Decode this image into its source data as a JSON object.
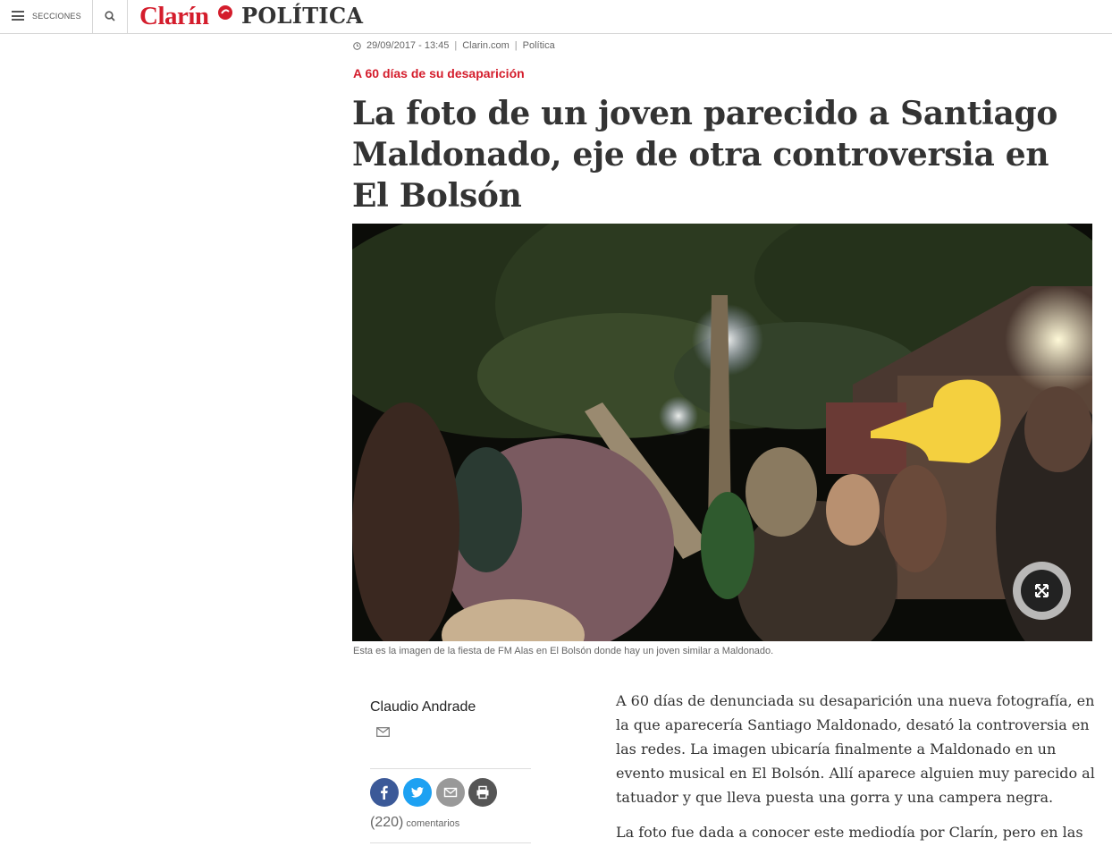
{
  "header": {
    "menu_label": "SECCIONES",
    "logo_text": "Clarín",
    "section_title": "POLÍTICA",
    "icons": {
      "menu": "hamburger-icon",
      "search": "search-icon"
    }
  },
  "meta": {
    "date": "29/09/2017 - 13:45",
    "source": "Clarin.com",
    "section": "Política",
    "icon": "clock-icon"
  },
  "article": {
    "kicker": "A 60 días de su desaparición",
    "headline": "La foto de un joven parecido a Santiago Maldonado, eje de otra controversia en El Bolsón",
    "photo_caption": "Esta es la imagen de la fiesta de FM Alas en El Bolsón donde hay un joven similar a Maldonado.",
    "author": "Claudio Andrade",
    "comments_count": "(220)",
    "comments_label": "comentarios",
    "paragraphs": [
      "A 60 días de denunciada su desaparición una nueva fotografía, en la que aparecería Santiago Maldonado, desató la controversia en las redes. La imagen ubicaría finalmente a Maldonado en un evento musical en El Bolsón. Allí aparece alguien muy parecido al tatuador y que lleva puesta una gorra y una campera negra.",
      "La foto fue dada a conocer este mediodía por Clarín, pero en las"
    ]
  },
  "share": [
    "facebook-icon",
    "twitter-icon",
    "email-icon",
    "print-icon"
  ],
  "colors": {
    "brand": "#d41d2c",
    "facebook": "#3b5998",
    "twitter": "#1da1f2",
    "text": "#333333"
  }
}
